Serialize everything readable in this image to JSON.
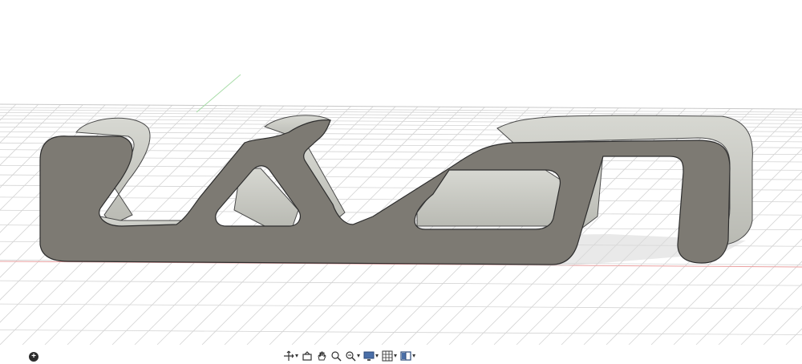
{
  "viewport": {
    "background": "#ffffff",
    "grid_color": "#d4d4d4",
    "model_face_color": "#7d7a73",
    "model_side_color": "#c9cac4",
    "x_axis_color": "#e88b8b",
    "y_axis_color": "#9bd49b"
  },
  "bottom_left": {
    "icon": "plus-icon",
    "glyph": "+"
  },
  "toolbar": {
    "items": [
      {
        "name": "orbit-icon",
        "has_menu": true
      },
      {
        "name": "look-at-icon",
        "has_menu": false
      },
      {
        "name": "pan-hand-icon",
        "has_menu": false
      },
      {
        "name": "zoom-icon",
        "has_menu": false
      },
      {
        "name": "fit-view-icon",
        "has_menu": true
      },
      {
        "name": "display-settings-icon",
        "has_menu": true
      },
      {
        "name": "grid-snaps-icon",
        "has_menu": true
      },
      {
        "name": "viewports-icon",
        "has_menu": true
      }
    ],
    "caret": "▾"
  }
}
